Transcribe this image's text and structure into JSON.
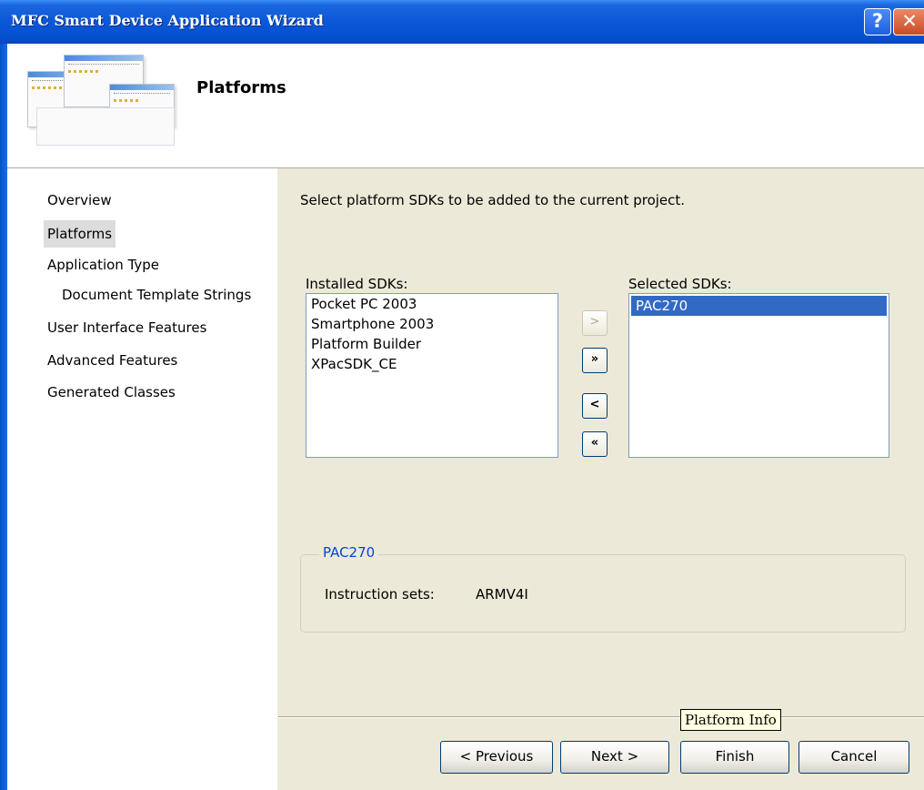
{
  "window": {
    "title": "MFC Smart Device Application Wizard",
    "help_glyph": "?",
    "close_glyph": "✕"
  },
  "header": {
    "title": "Platforms",
    "image_icon": "wizard-windows-icon"
  },
  "nav": {
    "items": [
      {
        "label": "Overview",
        "active": false
      },
      {
        "label": "Platforms",
        "active": true
      },
      {
        "label": "Application Type",
        "active": false
      },
      {
        "label": "Document Template Strings",
        "active": false,
        "sub": true
      },
      {
        "label": "User Interface Features",
        "active": false
      },
      {
        "label": "Advanced Features",
        "active": false
      },
      {
        "label": "Generated Classes",
        "active": false
      }
    ]
  },
  "main": {
    "instruction": "Select platform SDKs to be added to the current project.",
    "installed_label": "Installed SDKs:",
    "installed_items": [
      "Pocket PC 2003",
      "Smartphone 2003",
      "Platform Builder",
      "XPacSDK_CE"
    ],
    "selected_label": "Selected SDKs:",
    "selected_items": [
      "PAC270"
    ],
    "move_buttons": {
      "add": ">",
      "add_all": "»",
      "remove": "<",
      "remove_all": "«"
    },
    "platform_info": {
      "title": "PAC270",
      "instruction_sets_label": "Instruction sets:",
      "instruction_sets_value": "ARMV4I"
    }
  },
  "footer": {
    "previous": "< Previous",
    "next": "Next >",
    "finish": "Finish",
    "cancel": "Cancel"
  },
  "tooltip": {
    "text": "Platform Info"
  },
  "colors": {
    "titlebar": "#0a58d8",
    "selection": "#316ac5",
    "group_title": "#0046d5",
    "dialog_bg": "#ece9d8"
  }
}
